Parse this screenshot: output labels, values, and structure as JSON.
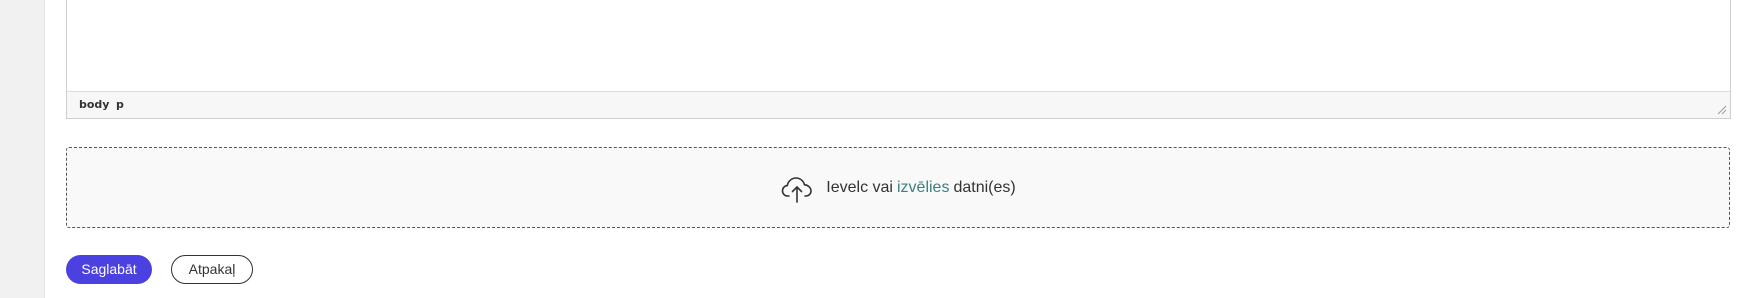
{
  "editor": {
    "path": [
      "body",
      "p"
    ]
  },
  "dropzone": {
    "icon": "cloud-upload-icon",
    "text_before": "Ievelc vai",
    "link": "izvēlies",
    "text_after": "datni(es)",
    "link_color": "#3b8083"
  },
  "actions": {
    "save_label": "Saglabāt",
    "back_label": "Atpakaļ",
    "primary_color": "#4b40e0"
  }
}
